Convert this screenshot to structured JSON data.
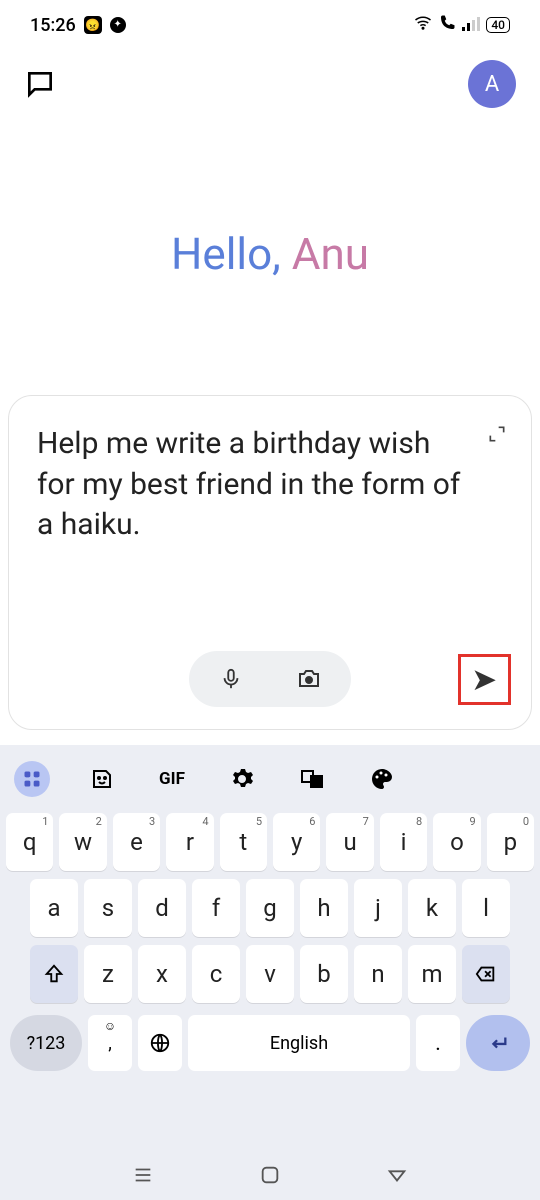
{
  "status": {
    "time": "15:26",
    "battery": "40"
  },
  "header": {
    "avatar_initial": "A"
  },
  "greeting": {
    "hello": "Hello, ",
    "name": "Anu"
  },
  "prompt": {
    "text": "Help me write a birthday wish for my best friend in the form of a haiku."
  },
  "keyboard": {
    "tools": {
      "gif": "GIF"
    },
    "row1": [
      {
        "k": "q",
        "n": "1"
      },
      {
        "k": "w",
        "n": "2"
      },
      {
        "k": "e",
        "n": "3"
      },
      {
        "k": "r",
        "n": "4"
      },
      {
        "k": "t",
        "n": "5"
      },
      {
        "k": "y",
        "n": "6"
      },
      {
        "k": "u",
        "n": "7"
      },
      {
        "k": "i",
        "n": "8"
      },
      {
        "k": "o",
        "n": "9"
      },
      {
        "k": "p",
        "n": "0"
      }
    ],
    "row2": [
      "a",
      "s",
      "d",
      "f",
      "g",
      "h",
      "j",
      "k",
      "l"
    ],
    "row3": [
      "z",
      "x",
      "c",
      "v",
      "b",
      "n",
      "m"
    ],
    "sym": "?123",
    "comma": ",",
    "space": "English",
    "dot": ".",
    "enter": "↵"
  }
}
